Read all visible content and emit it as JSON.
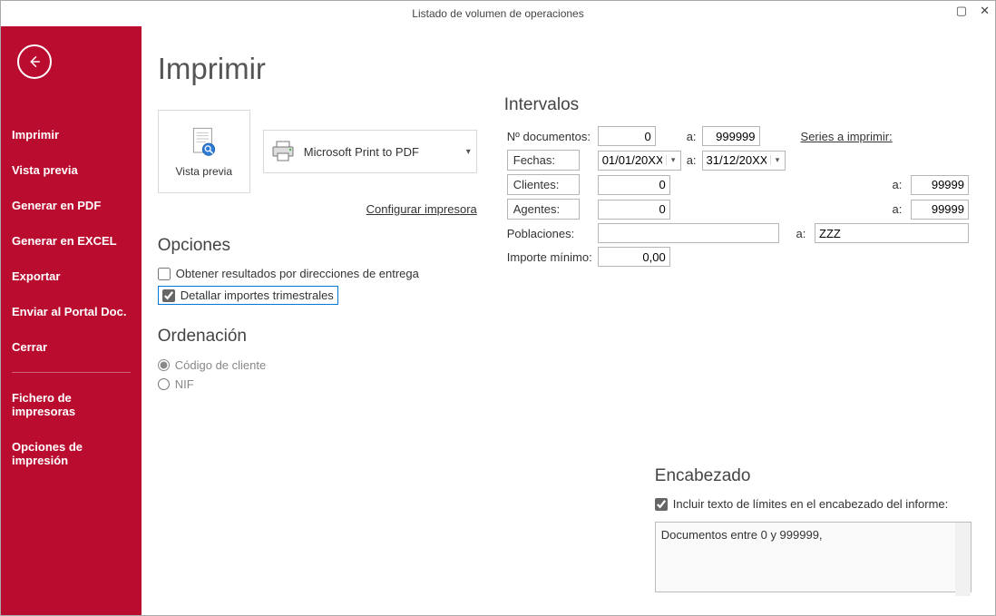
{
  "window": {
    "title": "Listado de volumen de operaciones"
  },
  "sidebar": {
    "items": [
      {
        "label": "Imprimir"
      },
      {
        "label": "Vista previa"
      },
      {
        "label": "Generar en PDF"
      },
      {
        "label": "Generar en EXCEL"
      },
      {
        "label": "Exportar"
      },
      {
        "label": "Enviar al Portal Doc."
      },
      {
        "label": "Cerrar"
      }
    ],
    "extra": [
      {
        "label": "Fichero de impresoras"
      },
      {
        "label": "Opciones de impresión"
      }
    ]
  },
  "page": {
    "title": "Imprimir",
    "preview_label": "Vista previa",
    "printer": "Microsoft Print to PDF",
    "configure_link": "Configurar impresora"
  },
  "options": {
    "title": "Opciones",
    "delivery_label": "Obtener resultados por direcciones de entrega",
    "delivery_checked": false,
    "quarterly_label": "Detallar importes trimestrales",
    "quarterly_checked": true
  },
  "ordering": {
    "title": "Ordenación",
    "radio_client": "Código de cliente",
    "radio_nif": "NIF"
  },
  "intervals": {
    "title": "Intervalos",
    "docs_label": "Nº documentos:",
    "docs_from": "0",
    "docs_to": "999999",
    "series_link": "Series a imprimir:",
    "dates_label": "Fechas:",
    "date_from": "01/01/20XX",
    "date_to": "31/12/20XX",
    "clients_label": "Clientes:",
    "clients_from": "0",
    "clients_to": "99999",
    "agents_label": "Agentes:",
    "agents_from": "0",
    "agents_to": "99999",
    "poblaciones_label": "Poblaciones:",
    "poblaciones_from": "",
    "poblaciones_to": "ZZZ",
    "importe_label": "Importe mínimo:",
    "importe_value": "0,00",
    "a": "a:"
  },
  "header": {
    "title": "Encabezado",
    "include_label": "Incluir texto de límites en el encabezado del informe:",
    "include_checked": true,
    "text": "Documentos entre 0 y 999999,"
  }
}
